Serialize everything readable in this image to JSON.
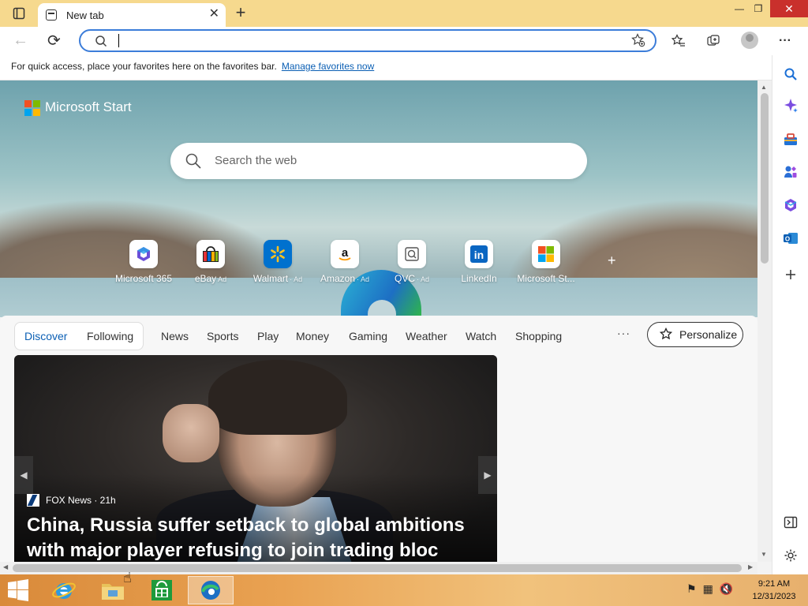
{
  "window": {
    "tab_title": "New tab",
    "tab_close": "✕",
    "new_tab": "+",
    "minimize": "—",
    "maximize": "❐",
    "close": "✕"
  },
  "toolbar": {
    "back": "←",
    "refresh": "⟳",
    "address_value": "",
    "address_placeholder": "",
    "more": "···"
  },
  "favorites_bar": {
    "message": "For quick access, place your favorites here on the favorites bar.",
    "link": "Manage favorites now"
  },
  "start": {
    "brand": "Microsoft Start",
    "search_placeholder": "Search the web",
    "add_link": "+"
  },
  "quick_links": [
    {
      "label": "Microsoft 365",
      "ad": ""
    },
    {
      "label": "eBay",
      "ad": "Ad"
    },
    {
      "label": "Walmart",
      "ad": "· Ad"
    },
    {
      "label": "Amazon",
      "ad": "· Ad"
    },
    {
      "label": "QVC",
      "ad": "· Ad"
    },
    {
      "label": "LinkedIn",
      "ad": ""
    },
    {
      "label": "Microsoft St...",
      "ad": ""
    }
  ],
  "feed": {
    "tabs": [
      "Discover",
      "Following"
    ],
    "categories": [
      "News",
      "Sports",
      "Play",
      "Money",
      "Gaming",
      "Weather",
      "Watch",
      "Shopping"
    ],
    "more": "···",
    "personalize": "Personalize"
  },
  "card": {
    "source": "FOX News · 21h",
    "title": "China, Russia suffer setback to global ambitions with major player refusing to join trading bloc"
  },
  "taskbar": {
    "time": "9:21 AM",
    "date": "12/31/2023"
  },
  "colors": {
    "accent": "#0b5fb4",
    "titlebar": "#f6d98e",
    "close_red": "#c9302c"
  }
}
